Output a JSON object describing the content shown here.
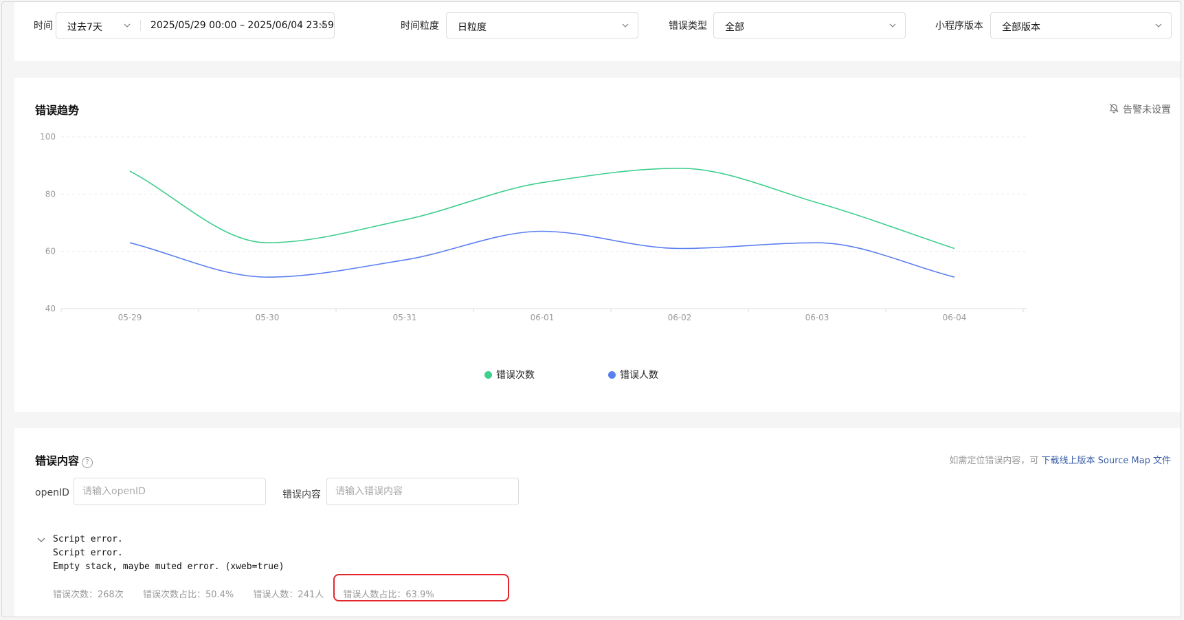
{
  "filters": {
    "time_label": "时间",
    "time_range_preset": "过去7天",
    "time_range_value": "2025/05/29 00:00 – 2025/06/04 23:59",
    "granularity_label": "时间粒度",
    "granularity_value": "日粒度",
    "error_type_label": "错误类型",
    "error_type_value": "全部",
    "version_label": "小程序版本",
    "version_value": "全部版本"
  },
  "trend": {
    "title": "错误趋势",
    "alert_label": "告警未设置"
  },
  "chart_data": {
    "type": "line",
    "categories": [
      "05-29",
      "05-30",
      "05-31",
      "06-01",
      "06-02",
      "06-03",
      "06-04"
    ],
    "ylim": [
      40,
      100
    ],
    "yticks": [
      "40",
      "60",
      "80",
      "100"
    ],
    "grid": true,
    "smooth": true,
    "legend_position": "bottom",
    "series": [
      {
        "name": "错误次数",
        "color": "#3fcf8e",
        "values": [
          88,
          63,
          71,
          84,
          89,
          77,
          61
        ]
      },
      {
        "name": "错误人数",
        "color": "#5b7ff0",
        "values": [
          63,
          51,
          57,
          67,
          61,
          63,
          51
        ]
      }
    ]
  },
  "error_content": {
    "title": "错误内容",
    "help_glyph": "?",
    "hint_prefix": "如需定位错误内容，可",
    "hint_link": "下载线上版本 Source Map 文件",
    "openid_label": "openID",
    "openid_placeholder": "请输入openID",
    "content_label": "错误内容",
    "content_placeholder": "请输入错误内容",
    "entry": {
      "message": "Script error.\nScript error.\nEmpty stack, maybe muted error. (xweb=true)",
      "count": "错误次数：268次",
      "count_ratio": "错误次数占比：50.4%",
      "users": "错误人数：241人",
      "users_ratio": "错误人数占比：63.9%"
    }
  },
  "colors": {
    "accent_link": "#3a5fa8",
    "highlight_border": "#e4252b"
  }
}
